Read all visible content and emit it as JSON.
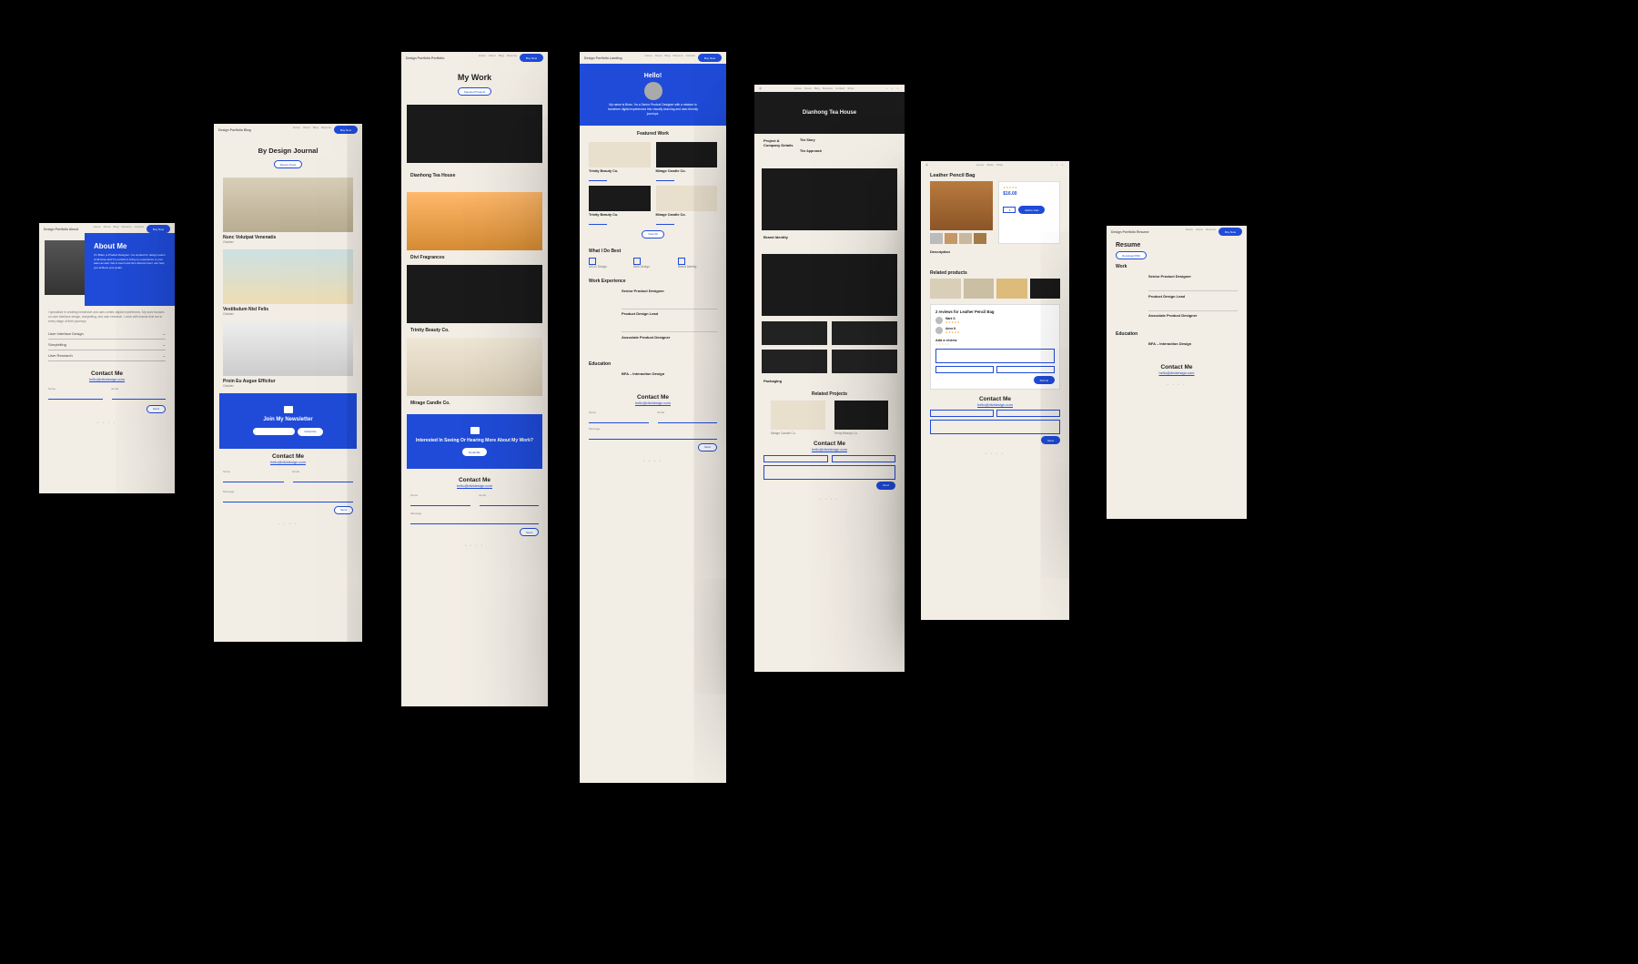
{
  "nav": {
    "items": [
      "Home",
      "About",
      "Blog",
      "Resume",
      "Contact",
      "Shop"
    ],
    "buy": "Buy Now"
  },
  "contact": {
    "heading": "Contact Me",
    "email": "hello@dividesign.com",
    "name_label": "Name",
    "email_label": "Email",
    "message_label": "Message",
    "send": "Send"
  },
  "foot_dots": "• • • •",
  "p1": {
    "browser": "Design Portfolio About",
    "title": "About Me",
    "intro": "I'm Brian, a Product Designer. I've worked for design teams of all sizes and I'm excited to bring my experience to your team as well. Get in touch and let's discuss how I can help you achieve your goals.",
    "body": "I specialize in creating immersive and user-centric digital experiences. My work focuses on user interface design, storytelling, and user research. I work with brands that are in every stage of their journeys.",
    "skills": [
      "User Interface Design",
      "Storytelling",
      "User Research"
    ]
  },
  "p2": {
    "browser": "Design Portfolio Blog",
    "title": "By Design Journal",
    "recent_btn": "Recent Posts",
    "posts": [
      {
        "title": "Nunc Volutpat Venenatis"
      },
      {
        "title": "Vestibulum Nisl Felis"
      },
      {
        "title": "Proin Eu Augue Efficitur"
      }
    ],
    "date": "October",
    "newsletter": {
      "title": "Join My Newsletter",
      "placeholder": "Email",
      "btn": "Subscribe"
    }
  },
  "p3": {
    "browser": "Design Portfolio Portfolio",
    "title": "My Work",
    "subtitle_btn": "Selected Projects",
    "projects": [
      {
        "title": "Dianhong Tea House"
      },
      {
        "title": "Divi Fragrances"
      },
      {
        "title": "Trinity Beauty Co."
      },
      {
        "title": "Mirage Candle Co."
      }
    ],
    "cta": {
      "line": "Interested In Seeing Or Hearing More About My Work?",
      "btn": "Email Me"
    }
  },
  "p4": {
    "browser": "Design Portfolio Landing",
    "hello": "Hello!",
    "intro": "My name is Brian. I'm a Senior Product Designer with a mission to transform digital experiences into visually stunning and user-friendly journeys.",
    "featured_h": "Featured Work",
    "featured": [
      {
        "title": "Trinity Beauty Co."
      },
      {
        "title": "Mirage Candle Co."
      },
      {
        "title": "Trinity Beauty Co."
      },
      {
        "title": "Mirage Candle Co."
      }
    ],
    "best_h": "What I Do Best",
    "best": [
      {
        "t": "UI/UX Design"
      },
      {
        "t": "Web Design"
      },
      {
        "t": "Brand Identity"
      }
    ],
    "view": "View All",
    "exp_h": "Work Experience",
    "exp": [
      {
        "role": "Senior Product Designer"
      },
      {
        "role": "Product Design Lead"
      },
      {
        "role": "Associate Product Designer"
      }
    ],
    "edu_h": "Education",
    "edu": {
      "role": "BFA – Interaction Design"
    }
  },
  "p5": {
    "browser": "Design Portfolio Project",
    "hero": "Dianhong Tea House",
    "sidebar_h": "Project & Company Details",
    "approach": "The Story",
    "approach2": "The Approach",
    "brand_h": "Brand Identity",
    "pack_h": "Packaging",
    "related_h": "Related Projects",
    "related": [
      {
        "t": "Mirage Candle Co."
      },
      {
        "t": "Trinity Beauty Co."
      }
    ]
  },
  "p6": {
    "browser": "Design Portfolio Shop",
    "product": "Leather Pencil Bag",
    "price": "$16.00",
    "qty": "1",
    "add": "Add to Cart",
    "desc_h": "Description",
    "related_h": "Related products",
    "reviews_h": "2 reviews for Leather Pencil Bag",
    "reviewers": [
      "Mark S.",
      "Anna K."
    ],
    "add_rev_h": "Add a review",
    "submit": "Submit"
  },
  "p7": {
    "browser": "Design Portfolio Resume",
    "title": "Resume",
    "dl": "Download PDF",
    "work_h": "Work",
    "roles": [
      "Senior Product Designer",
      "Product Design Lead",
      "Associate Product Designer"
    ],
    "edu_h": "Education",
    "edu": "BFA – Interaction Design"
  }
}
